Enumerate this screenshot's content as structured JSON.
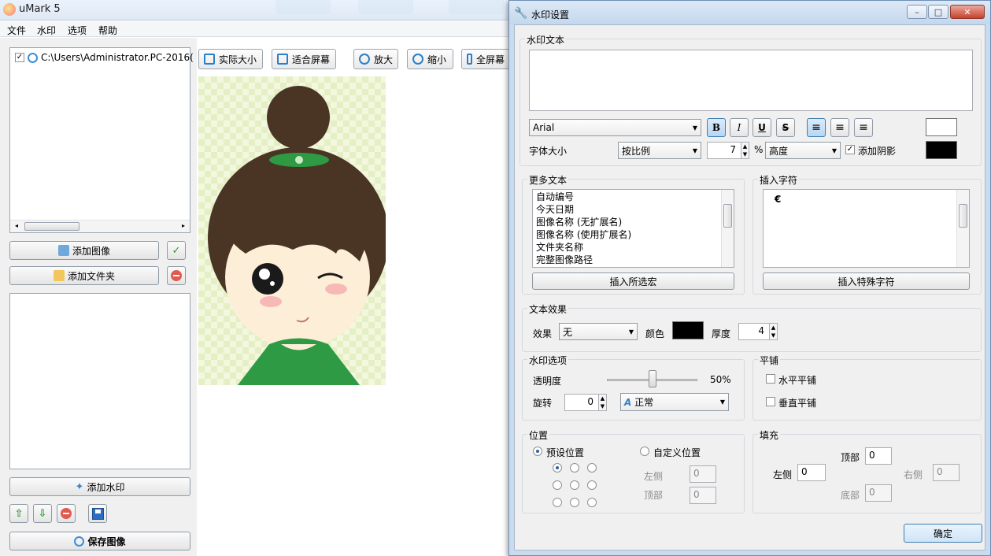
{
  "main": {
    "title": "uMark 5",
    "menu": [
      "文件",
      "水印",
      "选项",
      "帮助"
    ],
    "file_list": [
      {
        "checked": true,
        "path": "C:\\Users\\Administrator.PC-2016("
      }
    ],
    "buttons": {
      "add_image": "添加图像",
      "add_folder": "添加文件夹",
      "add_watermark": "添加水印",
      "save_image": "保存图像"
    },
    "toolbar": [
      "实际大小",
      "适合屏幕",
      "放大",
      "缩小",
      "全屏幕"
    ]
  },
  "dialog": {
    "title": "水印设置",
    "watermark_text": {
      "group_label": "水印文本",
      "value": "",
      "font": "Arial",
      "format_buttons": [
        "B",
        "I",
        "U",
        "S"
      ],
      "font_size_label": "字体大小",
      "size_mode": "按比例",
      "size_value": "7",
      "percent": "%",
      "dimension": "高度",
      "shadow_label": "添加阴影",
      "shadow_checked": true,
      "text_color": "#ffffff",
      "shadow_color": "#000000"
    },
    "more_text": {
      "group_label": "更多文本",
      "items": [
        "自动编号",
        "今天日期",
        "图像名称 (无扩展名)",
        "图像名称 (使用扩展名)",
        "文件夹名称",
        "完整图像路径"
      ],
      "insert_button": "插入所选宏"
    },
    "insert_char": {
      "group_label": "插入字符",
      "items": [
        "€"
      ],
      "insert_button": "插入特殊字符"
    },
    "text_effect": {
      "group_label": "文本效果",
      "effect_label": "效果",
      "effect_value": "无",
      "color_label": "颜色",
      "color": "#000000",
      "thickness_label": "厚度",
      "thickness_value": "4"
    },
    "watermark_options": {
      "group_label": "水印选项",
      "opacity_label": "透明度",
      "opacity_value": "50%",
      "opacity_fraction": 0.5,
      "rotate_label": "旋转",
      "rotate_value": "0",
      "rotate_mode": "正常"
    },
    "tile": {
      "group_label": "平铺",
      "horizontal": "水平平铺",
      "vertical": "垂直平铺"
    },
    "position": {
      "group_label": "位置",
      "preset": "预设位置",
      "custom": "自定义位置",
      "left_label": "左侧",
      "left_value": "0",
      "top_label": "顶部",
      "top_value": "0"
    },
    "padding": {
      "group_label": "填充",
      "top_label": "顶部",
      "top_value": "0",
      "left_label": "左侧",
      "left_value": "0",
      "right_label": "右侧",
      "right_value": "0",
      "bottom_label": "底部",
      "bottom_value": "0"
    },
    "ok_button": "确定"
  }
}
